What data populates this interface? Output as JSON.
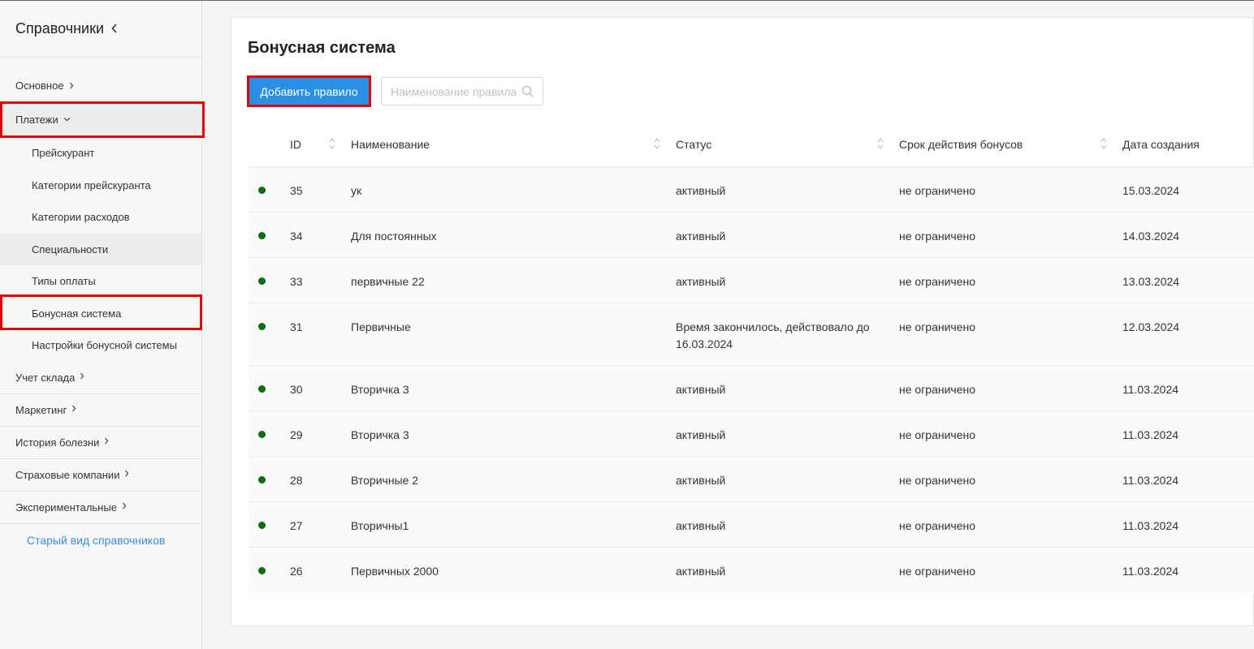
{
  "sidebar": {
    "title": "Справочники",
    "top_item": "Основное",
    "payments": "Платежи",
    "sub_items": [
      "Прейскурант",
      "Категории прейскуранта",
      "Категории расходов",
      "Специальности",
      "Типы оплаты",
      "Бонусная система",
      "Настройки бонусной системы"
    ],
    "groups": [
      "Учет склада",
      "Маркетинг",
      "История болезни",
      "Страховые компании",
      "Экспериментальные"
    ],
    "old_link": "Старый вид справочников"
  },
  "page": {
    "title": "Бонусная система",
    "add_button": "Добавить правило",
    "search_placeholder": "Наименование правила"
  },
  "table": {
    "columns": [
      "ID",
      "Наименование",
      "Статус",
      "Срок действия бонусов",
      "Дата создания"
    ],
    "rows": [
      {
        "id": "35",
        "name": "ук",
        "status": "активный",
        "term": "не ограничено",
        "date": "15.03.2024"
      },
      {
        "id": "34",
        "name": "Для постоянных",
        "status": "активный",
        "term": "не ограничено",
        "date": "14.03.2024"
      },
      {
        "id": "33",
        "name": "первичные 22",
        "status": "активный",
        "term": "не ограничено",
        "date": "13.03.2024"
      },
      {
        "id": "31",
        "name": "Первичные",
        "status": "Время закончилось, действовало до 16.03.2024",
        "term": "не ограничено",
        "date": "12.03.2024"
      },
      {
        "id": "30",
        "name": "Вторичка 3",
        "status": "активный",
        "term": "не ограничено",
        "date": "11.03.2024"
      },
      {
        "id": "29",
        "name": "Вторичка 3",
        "status": "активный",
        "term": "не ограничено",
        "date": "11.03.2024"
      },
      {
        "id": "28",
        "name": "Вторичные 2",
        "status": "активный",
        "term": "не ограничено",
        "date": "11.03.2024"
      },
      {
        "id": "27",
        "name": "Вторичны1",
        "status": "активный",
        "term": "не ограничено",
        "date": "11.03.2024"
      },
      {
        "id": "26",
        "name": "Первичных 2000",
        "status": "активный",
        "term": "не ограничено",
        "date": "11.03.2024"
      }
    ]
  },
  "colors": {
    "accent": "#2b8fe3",
    "highlight": "#e00000",
    "status_dot": "#0c6b0c",
    "link": "#3a8fd6"
  }
}
